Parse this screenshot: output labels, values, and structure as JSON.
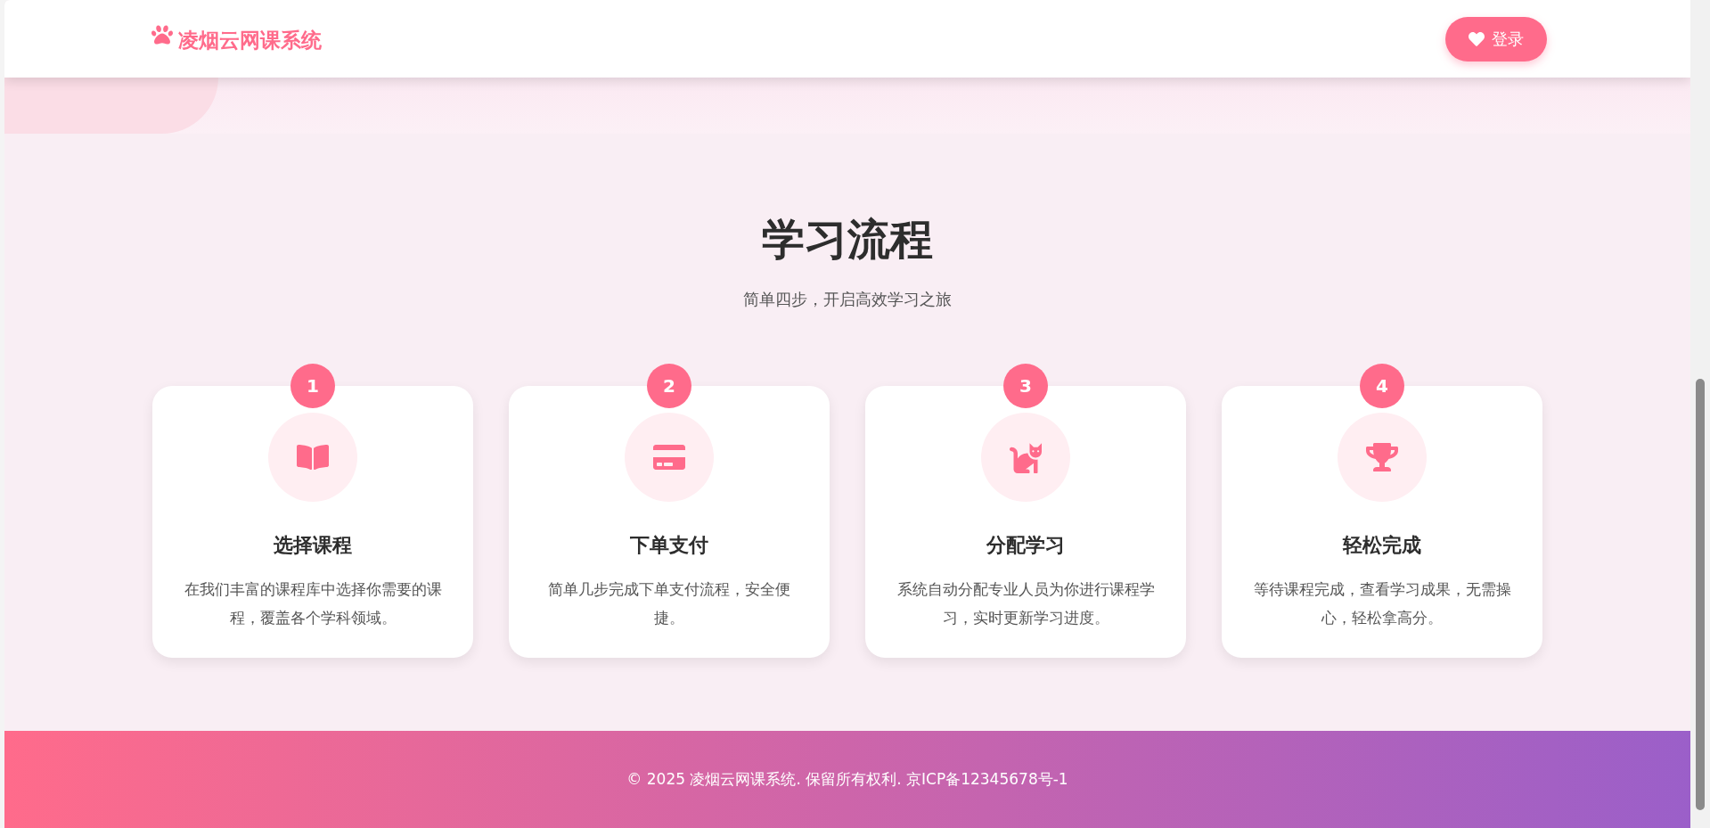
{
  "header": {
    "logo_text": "凌烟云网课系统",
    "login_button": "登录"
  },
  "section": {
    "title": "学习流程",
    "subtitle": "简单四步，开启高效学习之旅",
    "steps": [
      {
        "number": "1",
        "title": "选择课程",
        "description": "在我们丰富的课程库中选择你需要的课程，覆盖各个学科领域。"
      },
      {
        "number": "2",
        "title": "下单支付",
        "description": "简单几步完成下单支付流程，安全便捷。"
      },
      {
        "number": "3",
        "title": "分配学习",
        "description": "系统自动分配专业人员为你进行课程学习，实时更新学习进度。"
      },
      {
        "number": "4",
        "title": "轻松完成",
        "description": "等待课程完成，查看学习成果，无需操心，轻松拿高分。"
      }
    ]
  },
  "footer": {
    "text": "© 2025 凌烟云网课系统. 保留所有权利. 京ICP备12345678号-1"
  }
}
